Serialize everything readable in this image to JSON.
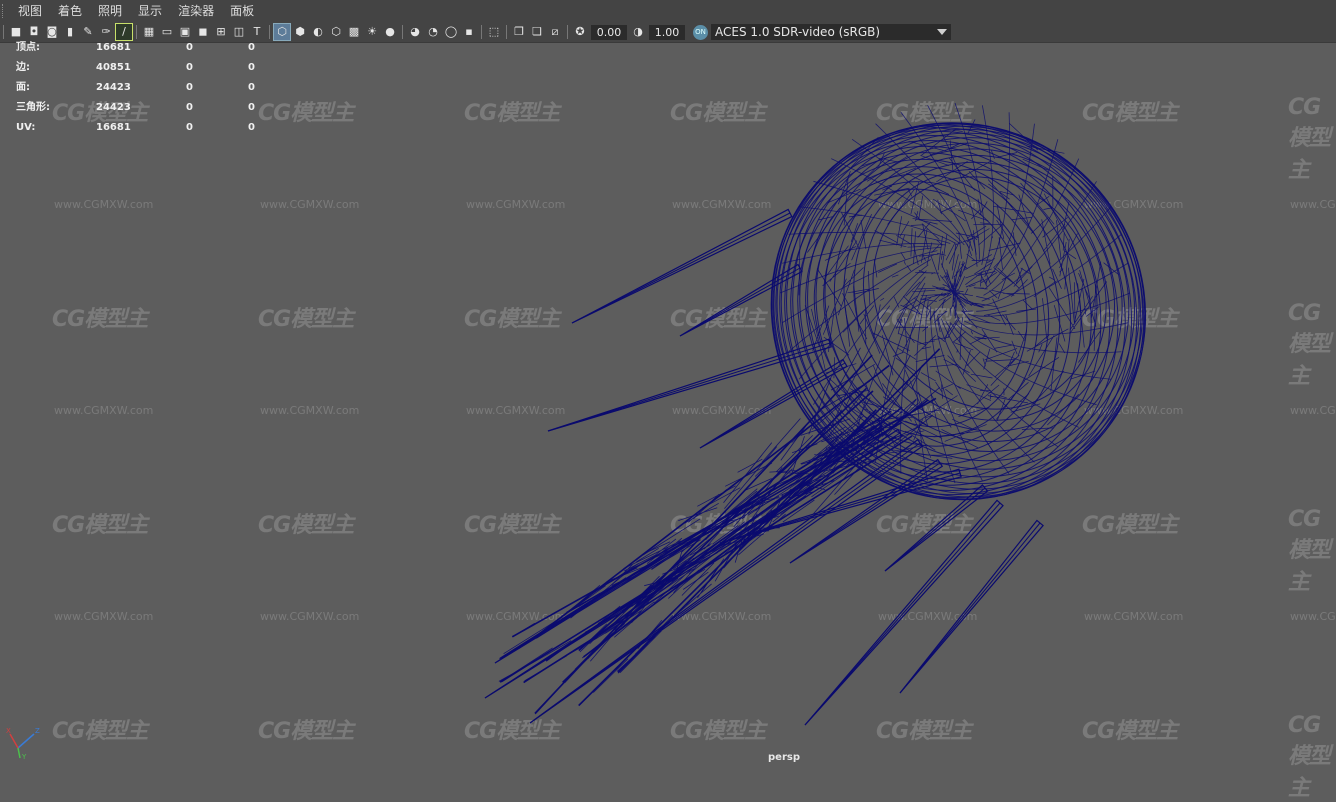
{
  "menu": [
    "视图",
    "着色",
    "照明",
    "显示",
    "渲染器",
    "面板"
  ],
  "toolbar": {
    "gamma_value": "0.00",
    "exposure_value": "1.00",
    "color_mgmt_badge": "ON",
    "color_space": "ACES 1.0 SDR-video (sRGB)"
  },
  "hud": {
    "rows": [
      {
        "label": "顶点:",
        "v1": "16681",
        "v2": "0",
        "v3": "0"
      },
      {
        "label": "边:",
        "v1": "40851",
        "v2": "0",
        "v3": "0"
      },
      {
        "label": "面:",
        "v1": "24423",
        "v2": "0",
        "v3": "0"
      },
      {
        "label": "三角形:",
        "v1": "24423",
        "v2": "0",
        "v3": "0"
      },
      {
        "label": "UV:",
        "v1": "16681",
        "v2": "0",
        "v3": "0"
      }
    ]
  },
  "watermark": {
    "logo": "CG模型主",
    "url": "www.CGMXW.com"
  },
  "camera_label": "persp",
  "axis_labels": {
    "x": "X",
    "y": "Y",
    "z": "Z"
  },
  "colors": {
    "viewport_bg": "#5d5d5d",
    "wireframe": "#0a0a6e",
    "panel_bg": "#444444",
    "accent": "#5b8fa8"
  }
}
